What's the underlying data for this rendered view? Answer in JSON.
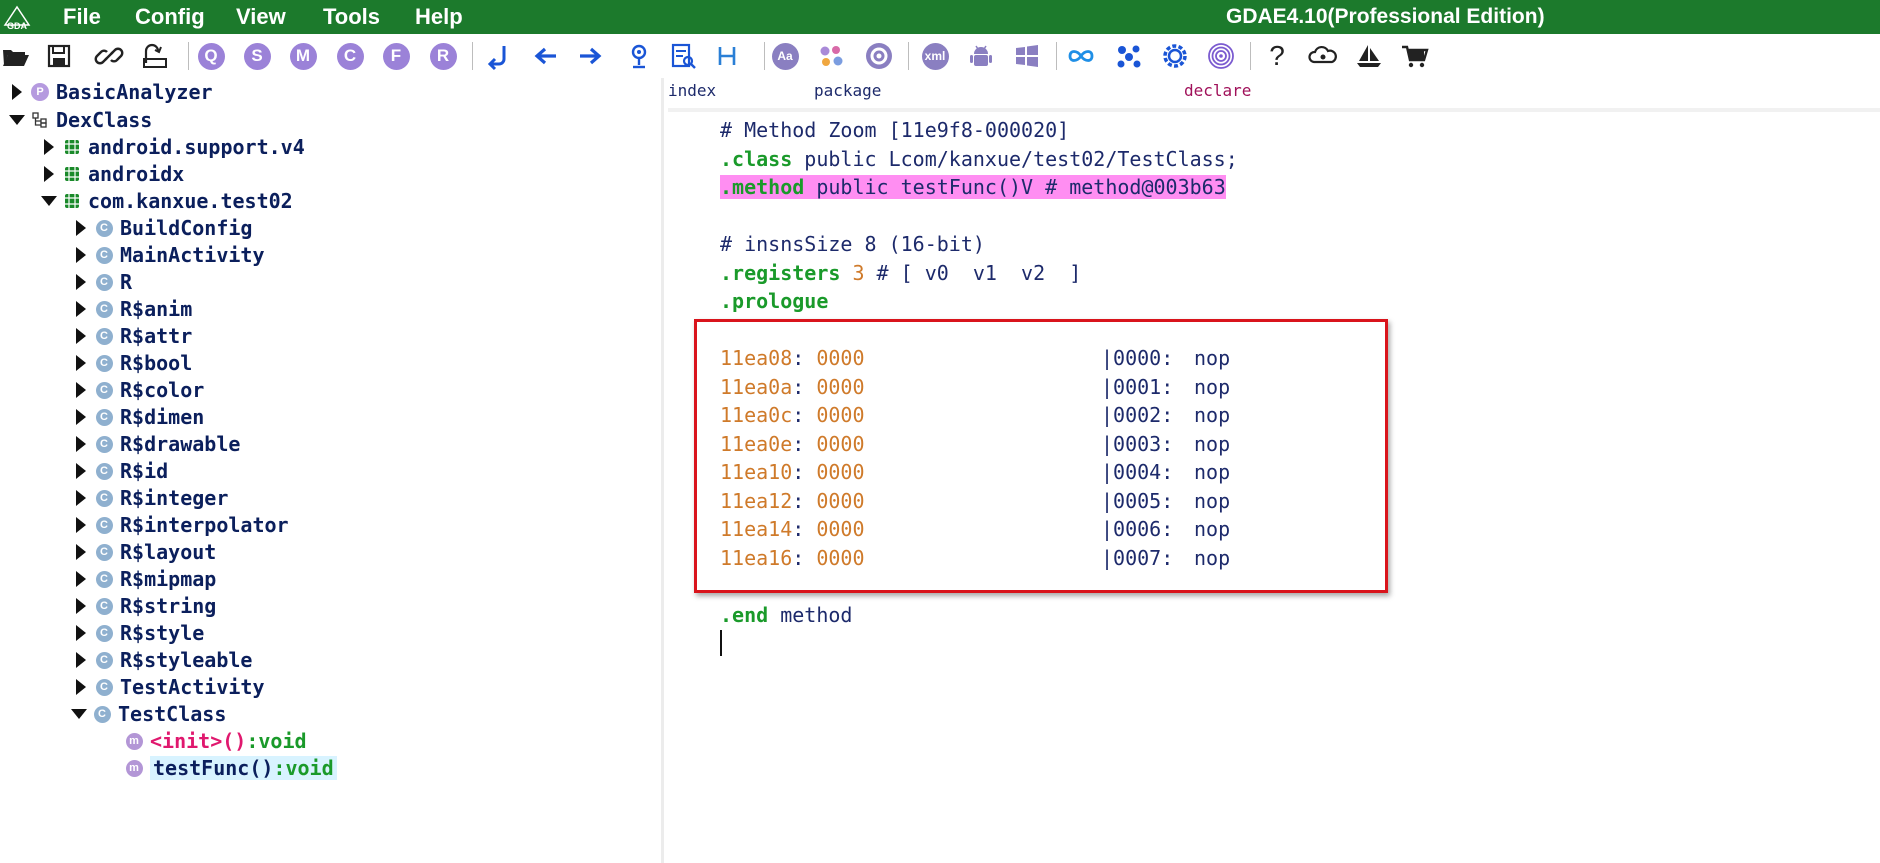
{
  "menubar": {
    "items": [
      "File",
      "Config",
      "View",
      "Tools",
      "Help"
    ],
    "title": "GDAE4.10(Professional Edition)",
    "logo_text": "GDA"
  },
  "toolbar": {
    "letter_buttons": [
      "Q",
      "S",
      "M",
      "C",
      "F",
      "R"
    ],
    "xml_label": "xml",
    "aa_label": "Aa",
    "help_label": "?"
  },
  "tree": {
    "root1": "BasicAnalyzer",
    "root2": "DexClass",
    "pkg1": "android.support.v4",
    "pkg2": "androidx",
    "pkg3": "com.kanxue.test02",
    "classes": [
      "BuildConfig",
      "MainActivity",
      "R",
      "R$anim",
      "R$attr",
      "R$bool",
      "R$color",
      "R$dimen",
      "R$drawable",
      "R$id",
      "R$integer",
      "R$interpolator",
      "R$layout",
      "R$mipmap",
      "R$string",
      "R$style",
      "R$styleable",
      "TestActivity"
    ],
    "open_class": "TestClass",
    "method1_name": "<init>()",
    "method1_type": ":void",
    "method2_name": "testFunc()",
    "method2_type": ":void"
  },
  "columns": {
    "index": "index",
    "package": "package",
    "declare": "declare"
  },
  "code": {
    "line1": "# Method Zoom [11e9f8-000020]",
    "line2_kw": ".class",
    "line2_rest": " public Lcom/kanxue/test02/TestClass;",
    "line3_kw": ".method",
    "line3_rest": " public testFunc()V # method@003b63",
    "line4": "# insnsSize 8 (16-bit)",
    "line5_kw": ".registers",
    "line5_num": " 3",
    "line5_rest": " # [ v0  v1  v2  ]",
    "line6_kw": ".prologue",
    "instructions": [
      {
        "addr": "11ea08",
        "hex": "0000",
        "idx": "|0000:",
        "op": "nop"
      },
      {
        "addr": "11ea0a",
        "hex": "0000",
        "idx": "|0001:",
        "op": "nop"
      },
      {
        "addr": "11ea0c",
        "hex": "0000",
        "idx": "|0002:",
        "op": "nop"
      },
      {
        "addr": "11ea0e",
        "hex": "0000",
        "idx": "|0003:",
        "op": "nop"
      },
      {
        "addr": "11ea10",
        "hex": "0000",
        "idx": "|0004:",
        "op": "nop"
      },
      {
        "addr": "11ea12",
        "hex": "0000",
        "idx": "|0005:",
        "op": "nop"
      },
      {
        "addr": "11ea14",
        "hex": "0000",
        "idx": "|0006:",
        "op": "nop"
      },
      {
        "addr": "11ea16",
        "hex": "0000",
        "idx": "|0007:",
        "op": "nop"
      }
    ],
    "end_kw": ".end",
    "end_rest": " method"
  },
  "colors": {
    "menubar_bg": "#1c7a2c",
    "keyword": "#1a9a2a",
    "address": "#cf7a2a",
    "highlight": "#ff8ef2",
    "annotation_box": "#d9141c"
  }
}
